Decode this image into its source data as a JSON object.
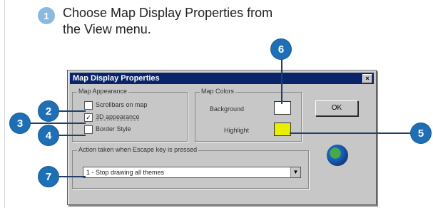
{
  "instruction": {
    "step": "1",
    "text": "Choose Map Display Properties from the View menu."
  },
  "dialog": {
    "title": "Map Display Properties",
    "close_glyph": "×",
    "appearance": {
      "label": "Map Appearance",
      "options": [
        {
          "label": "Scrollbars on map",
          "checked": false
        },
        {
          "label": "3D appearance",
          "checked": true
        },
        {
          "label": "Border Style",
          "checked": false
        }
      ]
    },
    "colors": {
      "label": "Map Colors",
      "background_label": "Background",
      "highlight_label": "Highlight",
      "background_color": "#ffffff",
      "highlight_color": "#e8f000"
    },
    "ok_label": "OK",
    "escape": {
      "label": "Action taken when Escape key is pressed",
      "value": "1 - Stop drawing all themes",
      "arrow": "▼"
    }
  },
  "callouts": [
    "2",
    "3",
    "4",
    "5",
    "6",
    "7"
  ]
}
